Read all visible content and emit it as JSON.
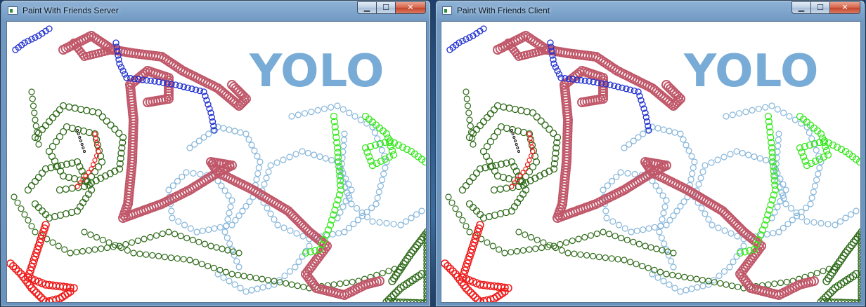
{
  "windows": [
    {
      "title": "Paint With Friends Server"
    },
    {
      "title": "Paint With Friends Client"
    }
  ],
  "controls": {
    "minimize": "▁",
    "maximize": "☐",
    "close": "✕"
  },
  "canvas": {
    "text": "YOLO",
    "colors": {
      "crimson": "#c0586a",
      "blue": "#1f2fd0",
      "darkgreen": "#2f6b1a",
      "lightblue": "#86b6da",
      "green": "#33e81a",
      "red": "#ee1c1c",
      "black": "#111111"
    }
  }
}
